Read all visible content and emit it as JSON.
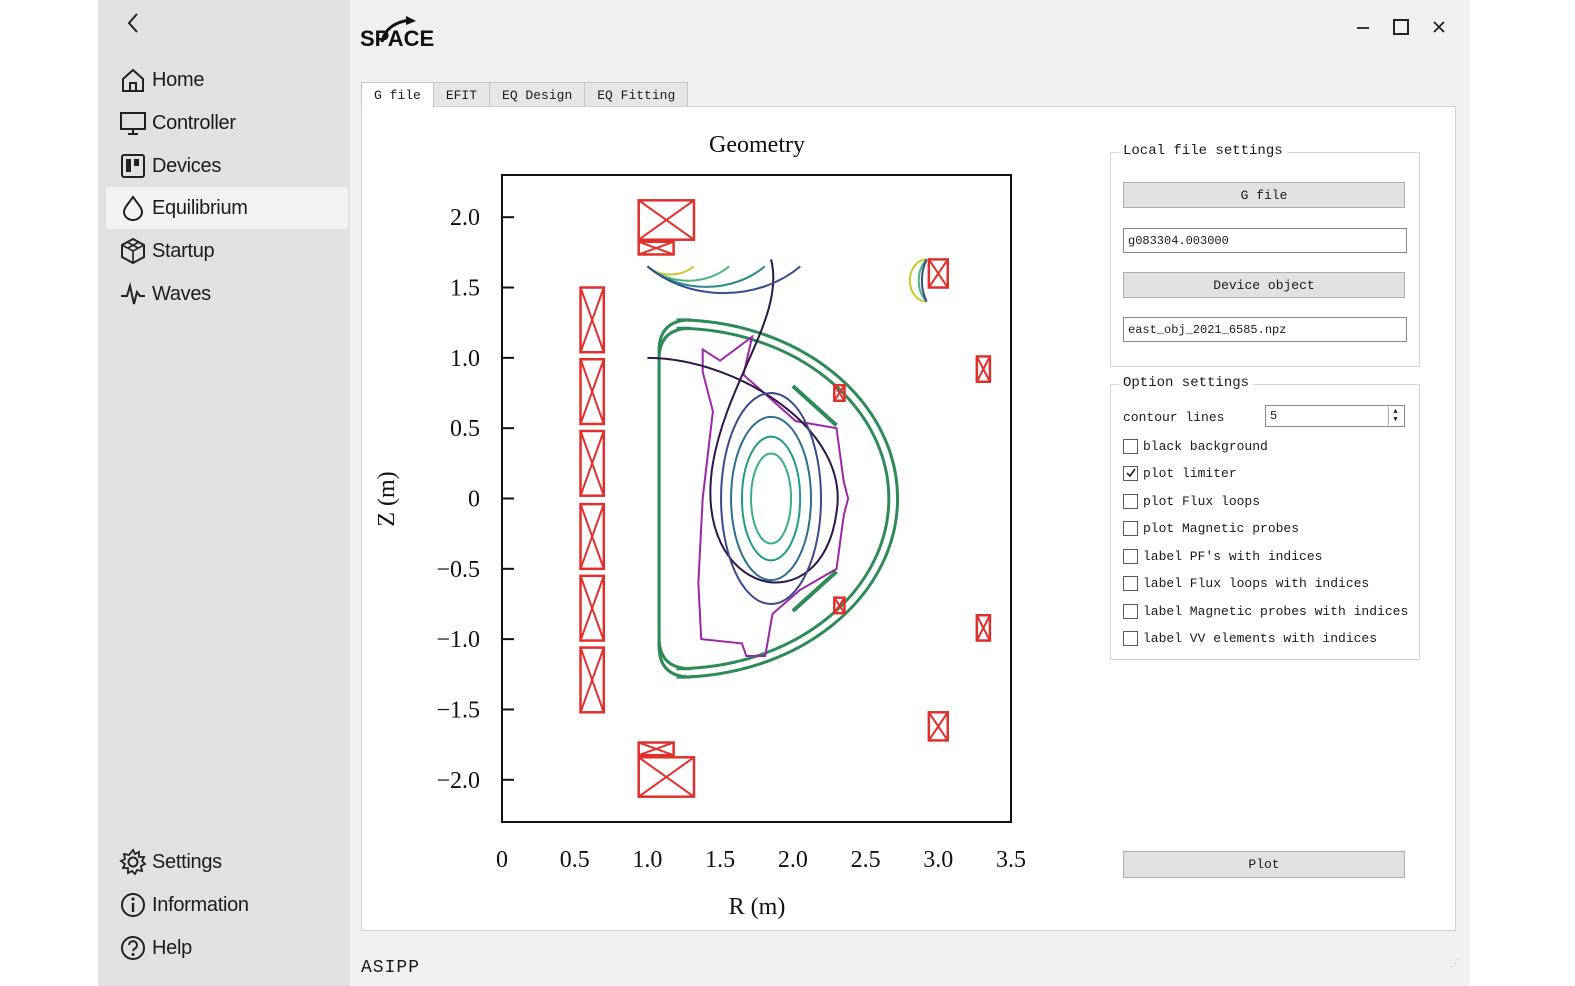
{
  "app": {
    "logo_text": "SPACE",
    "footer": "ASIPP"
  },
  "sidebar": {
    "items": [
      {
        "label": "Home",
        "icon": "home-icon"
      },
      {
        "label": "Controller",
        "icon": "monitor-icon"
      },
      {
        "label": "Devices",
        "icon": "devices-icon"
      },
      {
        "label": "Equilibrium",
        "icon": "drop-icon",
        "active": true
      },
      {
        "label": "Startup",
        "icon": "startup-icon"
      },
      {
        "label": "Waves",
        "icon": "waves-icon"
      }
    ],
    "bottom_items": [
      {
        "label": "Settings",
        "icon": "gear-icon"
      },
      {
        "label": "Information",
        "icon": "info-icon"
      },
      {
        "label": "Help",
        "icon": "help-icon"
      }
    ]
  },
  "tabs": [
    {
      "label": "G file",
      "active": true
    },
    {
      "label": "EFIT"
    },
    {
      "label": "EQ Design"
    },
    {
      "label": "EQ Fitting"
    }
  ],
  "chart_data": {
    "type": "line",
    "title": "Geometry",
    "xlabel": "R (m)",
    "ylabel": "Z (m)",
    "xlim": [
      0,
      3.5
    ],
    "ylim": [
      -2.3,
      2.3
    ],
    "xticks": [
      "0",
      "0.5",
      "1.0",
      "1.5",
      "2.0",
      "2.5",
      "3.0",
      "3.5"
    ],
    "yticks": [
      "2.0",
      "1.5",
      "1.0",
      "0.5",
      "0",
      "−0.5",
      "−1.0",
      "−1.5",
      "−2.0"
    ],
    "ytick_values": [
      2.0,
      1.5,
      1.0,
      0.5,
      0,
      -0.5,
      -1.0,
      -1.5,
      -2.0
    ],
    "xtick_values": [
      0,
      0.5,
      1.0,
      1.5,
      2.0,
      2.5,
      3.0,
      3.5
    ],
    "grid": false,
    "pf_coils": [
      {
        "r": 0.62,
        "z": 1.27,
        "w": 0.16,
        "h": 0.46
      },
      {
        "r": 0.62,
        "z": 0.76,
        "w": 0.16,
        "h": 0.46
      },
      {
        "r": 0.62,
        "z": 0.25,
        "w": 0.16,
        "h": 0.46
      },
      {
        "r": 0.62,
        "z": -0.27,
        "w": 0.16,
        "h": 0.46
      },
      {
        "r": 0.62,
        "z": -0.78,
        "w": 0.16,
        "h": 0.46
      },
      {
        "r": 0.62,
        "z": -1.29,
        "w": 0.16,
        "h": 0.46
      },
      {
        "r": 1.13,
        "z": 1.98,
        "w": 0.38,
        "h": 0.28
      },
      {
        "r": 1.06,
        "z": 1.78,
        "w": 0.24,
        "h": 0.09
      },
      {
        "r": 1.13,
        "z": -1.98,
        "w": 0.38,
        "h": 0.28
      },
      {
        "r": 1.06,
        "z": -1.78,
        "w": 0.24,
        "h": 0.09
      },
      {
        "r": 3.0,
        "z": 1.6,
        "w": 0.13,
        "h": 0.2
      },
      {
        "r": 3.31,
        "z": 0.92,
        "w": 0.09,
        "h": 0.18
      },
      {
        "r": 2.32,
        "z": 0.75,
        "w": 0.07,
        "h": 0.11
      },
      {
        "r": 2.32,
        "z": -0.76,
        "w": 0.07,
        "h": 0.11
      },
      {
        "r": 3.31,
        "z": -0.92,
        "w": 0.09,
        "h": 0.18
      },
      {
        "r": 3.0,
        "z": -1.62,
        "w": 0.13,
        "h": 0.2
      }
    ],
    "vessel": {
      "r0": 1.2,
      "a_outer": 1.52,
      "a_inner": 1.46,
      "b_outer": 1.27,
      "b_inner": 1.21
    },
    "flux_center": {
      "r": 1.85,
      "z": 0.0
    },
    "flux_contours": [
      {
        "a": 0.22,
        "b": 0.32,
        "color": "#3aae8a"
      },
      {
        "a": 0.32,
        "b": 0.44,
        "color": "#1f9a8a"
      },
      {
        "a": 0.44,
        "b": 0.58,
        "color": "#2c6e8e"
      },
      {
        "a": 0.55,
        "b": 0.75,
        "color": "#3d4a8a"
      }
    ],
    "color_limiter": "#9b27a6",
    "color_vessel": "#2e8b57",
    "color_coil": "#e0302e",
    "color_separatrix": "#2d1648"
  },
  "settings": {
    "local_title": "Local file settings",
    "gfile_button": "G file",
    "gfile_value": "g083304.003000",
    "device_button": "Device object",
    "device_value": "east_obj_2021_6585.npz",
    "option_title": "Option settings",
    "contour_label": "contour lines",
    "contour_value": "5",
    "options": [
      {
        "label": "black background",
        "checked": false
      },
      {
        "label": "plot limiter",
        "checked": true
      },
      {
        "label": "plot Flux loops",
        "checked": false
      },
      {
        "label": "plot Magnetic probes",
        "checked": false
      },
      {
        "label": "label PF's with indices",
        "checked": false
      },
      {
        "label": "label Flux loops with indices",
        "checked": false
      },
      {
        "label": "label Magnetic probes with indices",
        "checked": false
      },
      {
        "label": "label VV elements with indices",
        "checked": false
      }
    ],
    "plot_button": "Plot"
  }
}
